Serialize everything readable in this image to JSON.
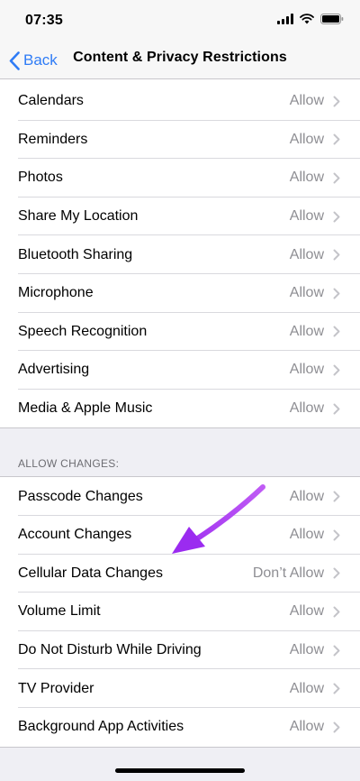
{
  "status_bar": {
    "time": "07:35",
    "icons": [
      "cellular-signal-icon",
      "wifi-icon",
      "battery-icon"
    ]
  },
  "nav": {
    "back_label": "Back",
    "title": "Content & Privacy Restrictions"
  },
  "privacy_items": [
    {
      "label": "Calendars",
      "value": "Allow"
    },
    {
      "label": "Reminders",
      "value": "Allow"
    },
    {
      "label": "Photos",
      "value": "Allow"
    },
    {
      "label": "Share My Location",
      "value": "Allow"
    },
    {
      "label": "Bluetooth Sharing",
      "value": "Allow"
    },
    {
      "label": "Microphone",
      "value": "Allow"
    },
    {
      "label": "Speech Recognition",
      "value": "Allow"
    },
    {
      "label": "Advertising",
      "value": "Allow"
    },
    {
      "label": "Media & Apple Music",
      "value": "Allow"
    }
  ],
  "allow_changes": {
    "header": "ALLOW CHANGES:",
    "items": [
      {
        "label": "Passcode Changes",
        "value": "Allow"
      },
      {
        "label": "Account Changes",
        "value": "Allow"
      },
      {
        "label": "Cellular Data Changes",
        "value": "Don’t Allow"
      },
      {
        "label": "Volume Limit",
        "value": "Allow"
      },
      {
        "label": "Do Not Disturb While Driving",
        "value": "Allow"
      },
      {
        "label": "TV Provider",
        "value": "Allow"
      },
      {
        "label": "Background App Activities",
        "value": "Allow"
      }
    ]
  },
  "colors": {
    "accent": "#2f7cf6",
    "annotation_arrow": "#9b2bf0",
    "secondary_text": "#8e8e93",
    "grouped_background": "#efeff4"
  }
}
